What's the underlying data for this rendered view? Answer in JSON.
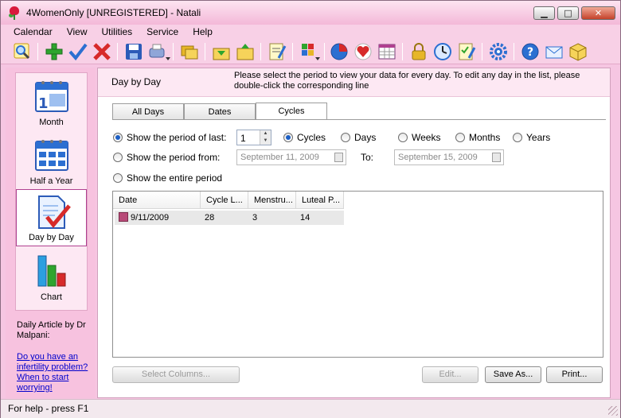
{
  "window": {
    "title": "4WomenOnly [UNREGISTERED] - Natali",
    "controls": {
      "minimize": "▁",
      "maximize": "□",
      "close": "✕"
    }
  },
  "menu": [
    "Calendar",
    "View",
    "Utilities",
    "Service",
    "Help"
  ],
  "toolbar": {
    "icons": [
      "search-icon",
      "add-icon",
      "check-icon",
      "delete-icon",
      "save-icon",
      "print-dropdown-icon",
      "folders-icon",
      "import-icon",
      "export-icon",
      "notes-icon",
      "color-palette-icon",
      "pie-chart-icon",
      "heart-icon",
      "calendar-grid-icon",
      "lock-icon",
      "clock-icon",
      "checklist-icon",
      "gear-icon",
      "help-icon",
      "mail-icon",
      "package-icon"
    ],
    "colors": {
      "green": "#2ea52e",
      "blue": "#2c6fd1",
      "red": "#d72a2a",
      "yellow": "#e7b628"
    }
  },
  "nav": {
    "items": [
      {
        "label": "Month",
        "icon": "month-calendar-icon"
      },
      {
        "label": "Half a Year",
        "icon": "half-year-calendar-icon"
      },
      {
        "label": "Day by Day",
        "icon": "day-by-day-icon",
        "selected": true
      },
      {
        "label": "Chart",
        "icon": "chart-icon"
      }
    ],
    "article_heading": "Daily Article by Dr Malpani:",
    "article_link": "Do you have an infertility problem? When to start worrying!"
  },
  "header": {
    "title": "Day by Day",
    "description": "Please select the period to view your data for every day. To edit any day in the list, please double-click the corresponding line"
  },
  "tabs": [
    {
      "label": "All Days",
      "active": false
    },
    {
      "label": "Dates",
      "active": false
    },
    {
      "label": "Cycles",
      "active": true
    }
  ],
  "period": {
    "last_label": "Show the period of last:",
    "last_value": "1",
    "units": [
      {
        "label": "Cycles",
        "selected": true
      },
      {
        "label": "Days",
        "selected": false
      },
      {
        "label": "Weeks",
        "selected": false
      },
      {
        "label": "Months",
        "selected": false
      },
      {
        "label": "Years",
        "selected": false
      }
    ],
    "from_label": "Show the period from:",
    "from_value": "September 11, 2009",
    "to_label": "To:",
    "to_value": "September 15, 2009",
    "entire_label": "Show the entire period"
  },
  "grid": {
    "columns": [
      "Date",
      "Cycle L...",
      "Menstru...",
      "Luteal P..."
    ],
    "rows": [
      [
        "9/11/2009",
        "28",
        "3",
        "14"
      ]
    ]
  },
  "buttons": {
    "select_columns": "Select Columns...",
    "edit": "Edit...",
    "save_as": "Save As...",
    "print": "Print..."
  },
  "status": "For help - press F1"
}
